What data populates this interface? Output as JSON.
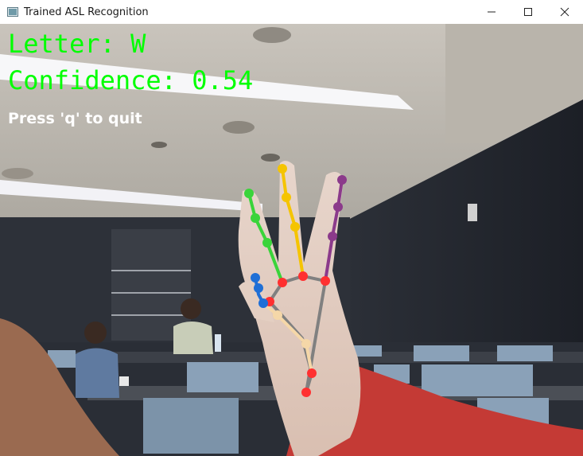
{
  "window": {
    "title": "Trained ASL Recognition",
    "controls": {
      "minimize": "minimize",
      "maximize": "maximize",
      "close": "close"
    }
  },
  "hud": {
    "letter": "Letter: W",
    "confidence": "Confidence: 0.54",
    "quit_hint": "Press 'q' to quit"
  },
  "colors": {
    "hud_text": "#00ff00",
    "hint_text": "#ffffff",
    "joint": "#ff3030",
    "palm_line": "#808080",
    "thumb": "#1f6fd6",
    "thumb_line": "#f5d7a8",
    "index": "#3ad43a",
    "middle": "#f5c400",
    "ring": "#8b3a8b"
  }
}
